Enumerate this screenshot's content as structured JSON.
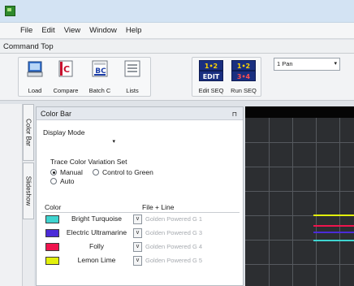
{
  "window": {
    "icon": "app-icon"
  },
  "menu": [
    "File",
    "Edit",
    "View",
    "Window",
    "Help"
  ],
  "command_bar_title": "Command Top",
  "toolbar": {
    "buttons": [
      {
        "label": "Load",
        "icon": "monitor-load-icon"
      },
      {
        "label": "Compare",
        "icon": "compare-c-icon",
        "glyph": "C",
        "glyph_color": "#c8102e"
      },
      {
        "label": "Batch C",
        "icon": "batch-bc-icon",
        "glyph": "BC",
        "glyph_color": "#1d3fa8"
      },
      {
        "label": "Lists",
        "icon": "lists-icon"
      },
      {
        "label": "Edit SEQ",
        "icon": "edit-seq-icon",
        "tile_top": "1•2",
        "tile_bottom": "EDIT"
      },
      {
        "label": "Run SEQ",
        "icon": "run-seq-icon",
        "tile_top": "1•2",
        "tile_bottom": "3•4"
      }
    ],
    "pan_value": "1  Pan",
    "pan_arrow": "▾"
  },
  "side_tabs": [
    "Color Bar",
    "Slideshow"
  ],
  "panel": {
    "title": "Color Bar",
    "pin": "⊓",
    "display_mode_label": "Display Mode",
    "display_mode_value": "",
    "trace_set_title": "Trace Color Variation Set",
    "radios": [
      {
        "label": "Manual",
        "checked": true
      },
      {
        "label": "Control to Green",
        "checked": false
      },
      {
        "label": "Auto",
        "checked": false
      }
    ],
    "columns": {
      "color": "Color",
      "file_line": "File + Line"
    },
    "rows": [
      {
        "name": "Bright Turquoise",
        "color": "#3fd4d0",
        "file": "Golden Powered G 1",
        "btn": "v"
      },
      {
        "name": "Electric Ultramarine",
        "color": "#4b2bd8",
        "file": "Golden Powered G 3",
        "btn": "v"
      },
      {
        "name": "Folly",
        "color": "#f0144e",
        "file": "Golden Powered G 4",
        "btn": "v"
      },
      {
        "name": "Lemon Lime",
        "color": "#e2f00c",
        "file": "Golden Powered G 5",
        "btn": "v"
      }
    ]
  },
  "view": {
    "traces": [
      {
        "color": "#e2f00c"
      },
      {
        "color": "#f0144e"
      },
      {
        "color": "#4b2bd8"
      },
      {
        "color": "#3fd4d0"
      }
    ]
  }
}
